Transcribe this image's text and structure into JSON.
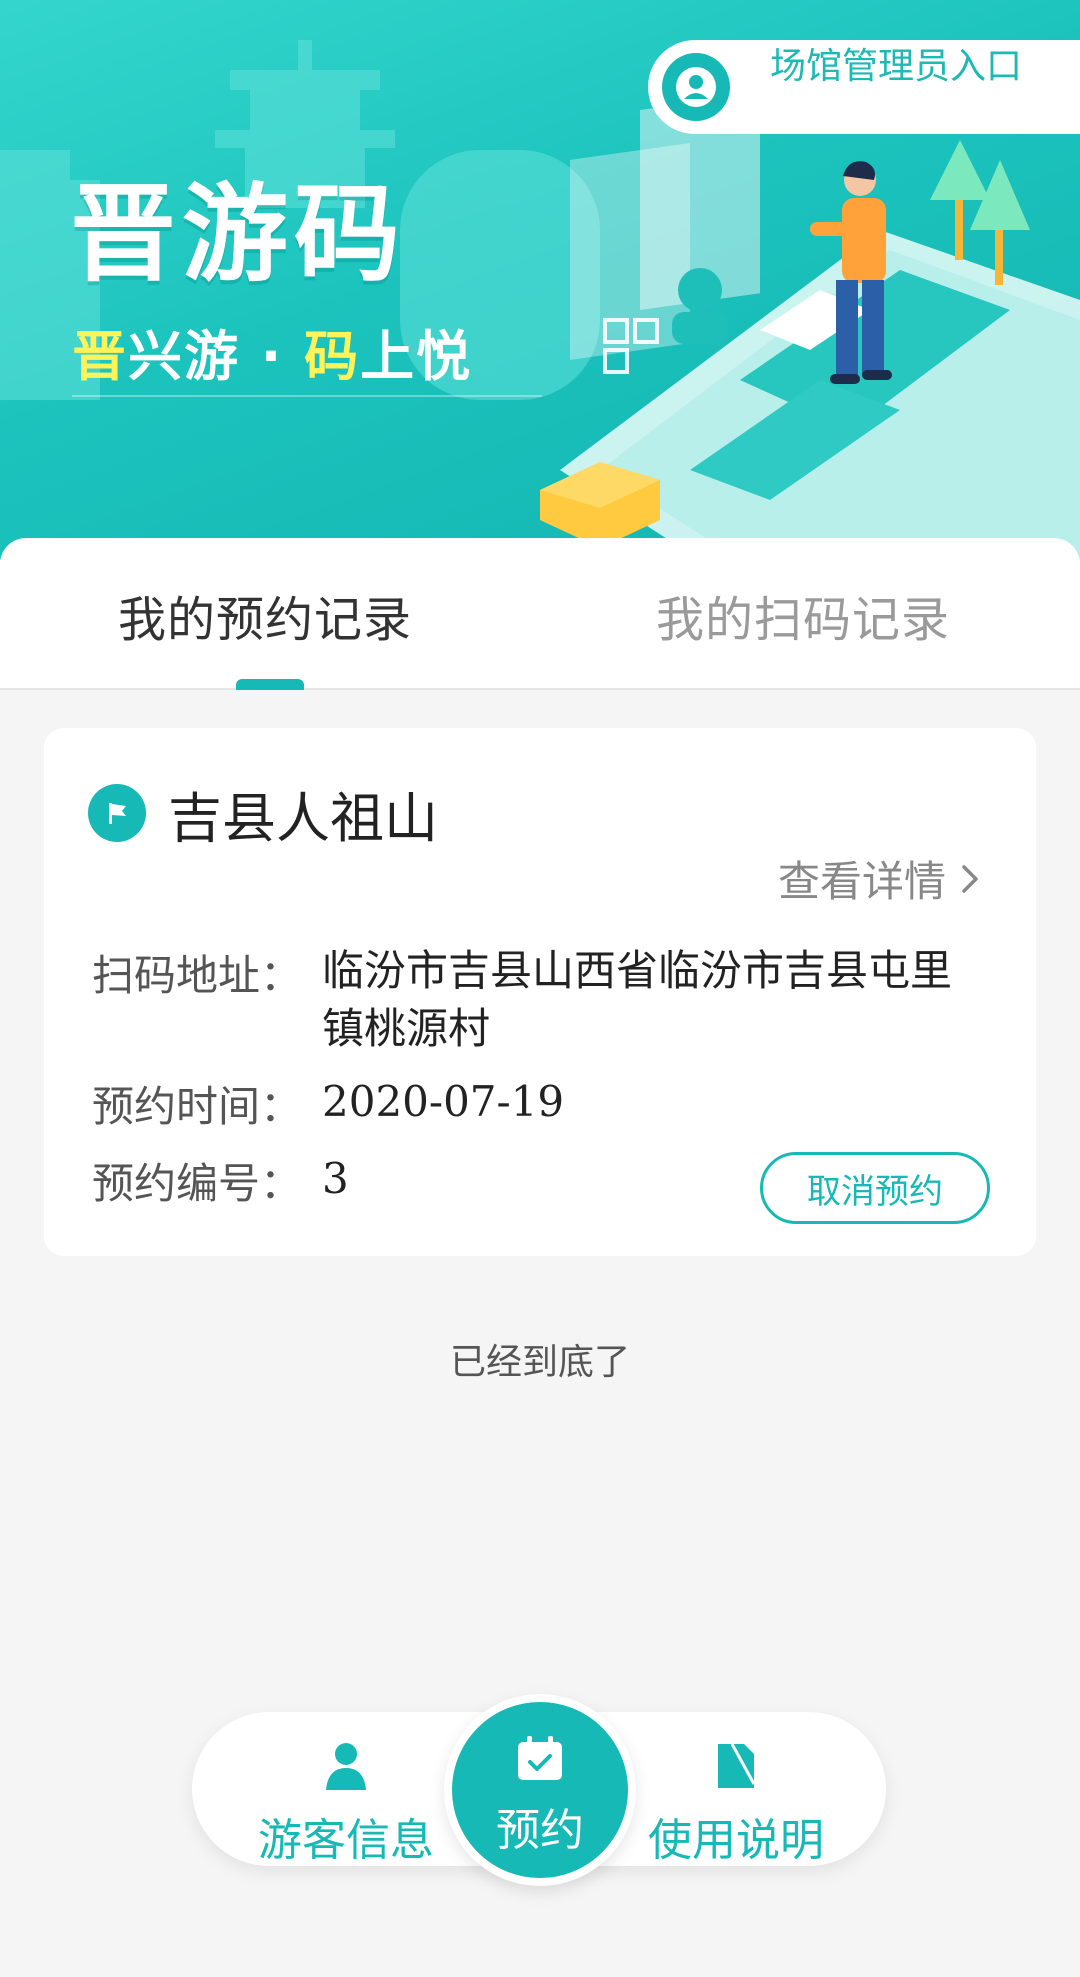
{
  "banner": {
    "title": "晋游码",
    "slogan_part1": "晋",
    "slogan_part2": "兴游 · ",
    "slogan_part3": "码",
    "slogan_part4": "上悦",
    "admin_entry_label": "场馆管理员入口"
  },
  "tabs": [
    {
      "label": "我的预约记录",
      "active": true
    },
    {
      "label": "我的扫码记录",
      "active": false
    }
  ],
  "reservation": {
    "venue_name": "吉县人祖山",
    "detail_link": "查看详情",
    "address_label": "扫码地址：",
    "address_value": "临汾市吉县山西省临汾市吉县屯里镇桃源村",
    "time_label": "预约时间：",
    "time_value": "2020-07-19",
    "number_label": "预约编号：",
    "number_value": "3",
    "cancel_label": "取消预约"
  },
  "list_end_text": "已经到底了",
  "bottom_nav": {
    "left_label": "游客信息",
    "center_label": "预约",
    "right_label": "使用说明"
  },
  "colors": {
    "accent": "#16b9b6",
    "banner_yellow": "#fff35a",
    "page_bg": "#f5f5f5"
  },
  "icons": {
    "admin": "user-avatar-icon",
    "venue": "flag-icon",
    "detail": "chevron-right-icon",
    "nav_left": "user-icon",
    "nav_center": "calendar-check-icon",
    "nav_right": "document-icon"
  }
}
